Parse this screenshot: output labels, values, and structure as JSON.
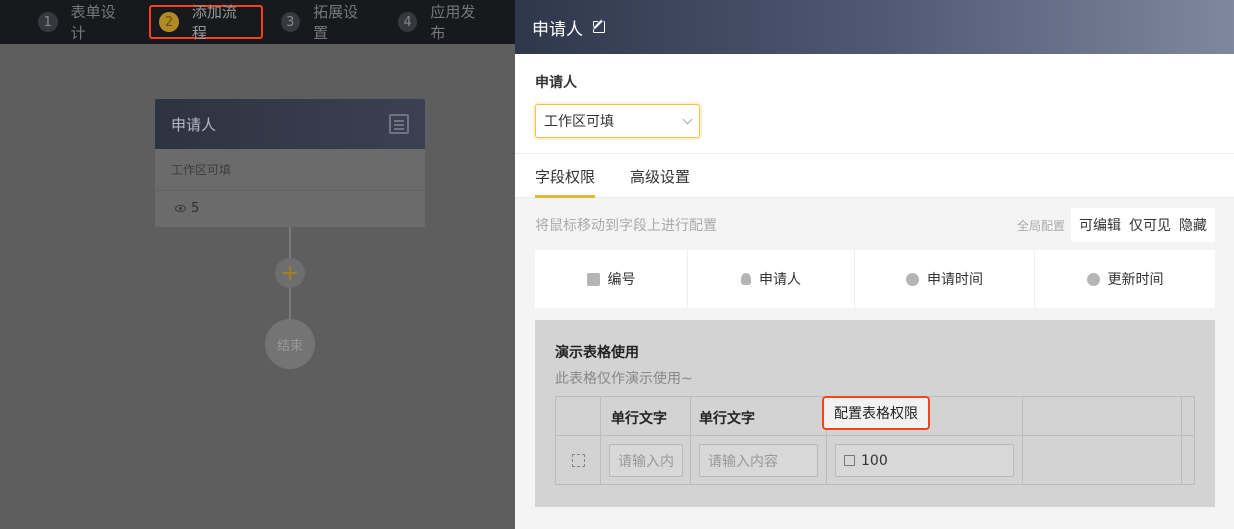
{
  "steps": [
    {
      "num": "1",
      "label": "表单设计"
    },
    {
      "num": "2",
      "label": "添加流程"
    },
    {
      "num": "3",
      "label": "拓展设置"
    },
    {
      "num": "4",
      "label": "应用发布"
    }
  ],
  "canvas": {
    "node_title": "申请人",
    "node_sub": "工作区可填",
    "node_count": "5",
    "add_symbol": "+",
    "end_label": "结束"
  },
  "drawer": {
    "title": "申请人",
    "applicant_label": "申请人",
    "select_value": "工作区可填",
    "tabs": [
      "字段权限",
      "高级设置"
    ],
    "hint": "将鼠标移动到字段上进行配置",
    "global_label": "全局配置",
    "perms": [
      "可编辑",
      "仅可见",
      "隐藏"
    ],
    "fields": [
      {
        "label": "编号",
        "icon": "number-icon"
      },
      {
        "label": "申请人",
        "icon": "user-icon"
      },
      {
        "label": "申请时间",
        "icon": "clock-icon"
      },
      {
        "label": "更新时间",
        "icon": "update-time-icon"
      }
    ],
    "table_title": "演示表格使用",
    "table_sub": "此表格仅作演示使用~",
    "col1": "单行文字",
    "col2": "单行文字",
    "cfg_btn": "配置表格权限",
    "input1_placeholder": "请输入内",
    "input2_placeholder": "请输入内容",
    "input3_value": "100"
  },
  "colors": {
    "accent": "#e8b530",
    "highlight": "#f3431b",
    "header_dark": "#2f374b"
  }
}
